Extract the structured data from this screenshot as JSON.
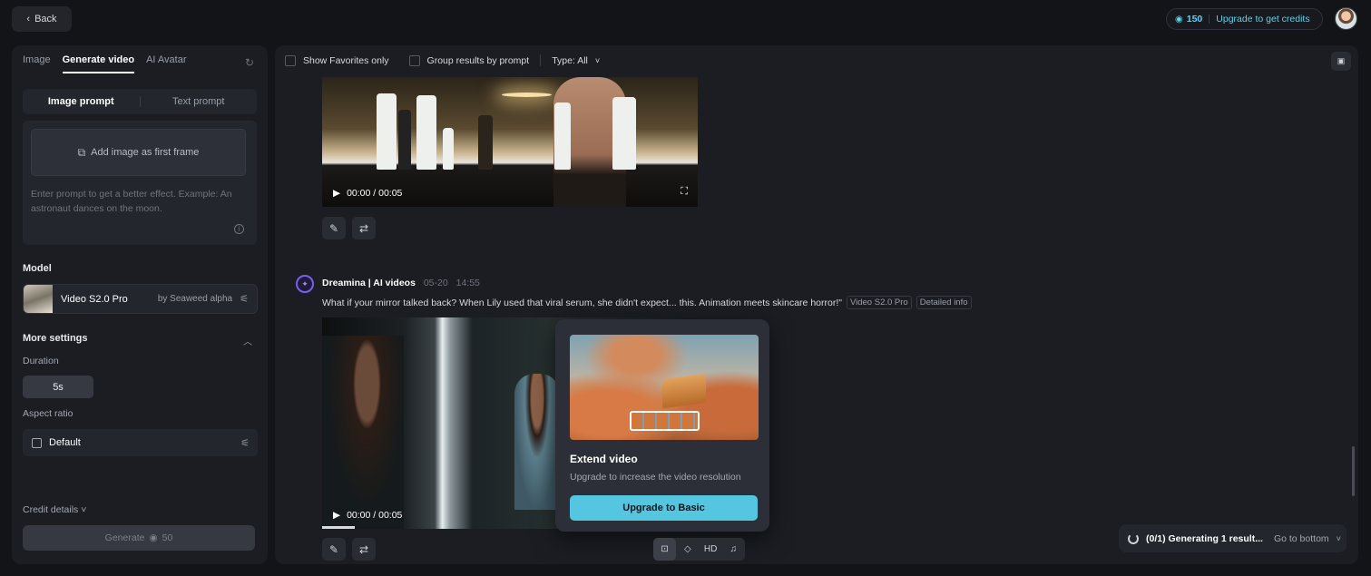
{
  "topbar": {
    "back_label": "Back",
    "credits_count": "150",
    "upgrade_label": "Upgrade to get credits"
  },
  "sidebar": {
    "tabs": [
      "Image",
      "Generate video",
      "AI Avatar"
    ],
    "prompt_modes": [
      "Image prompt",
      "Text prompt"
    ],
    "add_image_label": "Add image as first frame",
    "prompt_placeholder": "Enter prompt to get a better effect. Example: An astronaut dances on the moon.",
    "model_heading": "Model",
    "model_name": "Video S2.0 Pro",
    "model_by": "by Seaweed alpha",
    "more_settings": "More settings",
    "duration_label": "Duration",
    "duration_value": "5s",
    "aspect_label": "Aspect ratio",
    "aspect_value": "Default",
    "credit_details": "Credit details",
    "generate_label": "Generate",
    "generate_cost": "50"
  },
  "main": {
    "filters": {
      "favorites": "Show Favorites only",
      "group": "Group results by prompt",
      "type": "Type: All"
    },
    "video1": {
      "time": "00:00 / 00:05"
    },
    "message": {
      "author": "Dreamina | AI videos",
      "date": "05-20",
      "time": "14:55",
      "prompt": "What if your mirror talked back? When Lily used that viral serum, she didn't expect... this. Animation meets skincare horror!\"",
      "model_tag": "Video S2.0 Pro",
      "detail_tag": "Detailed info"
    },
    "video2": {
      "time": "00:00 / 00:05"
    },
    "popover": {
      "title": "Extend video",
      "subtitle": "Upgrade to increase the video resolution",
      "button": "Upgrade to Basic"
    },
    "tools": {
      "hd": "HD"
    },
    "status": {
      "generating": "(0/1) Generating 1 result...",
      "goto": "Go to bottom"
    }
  }
}
